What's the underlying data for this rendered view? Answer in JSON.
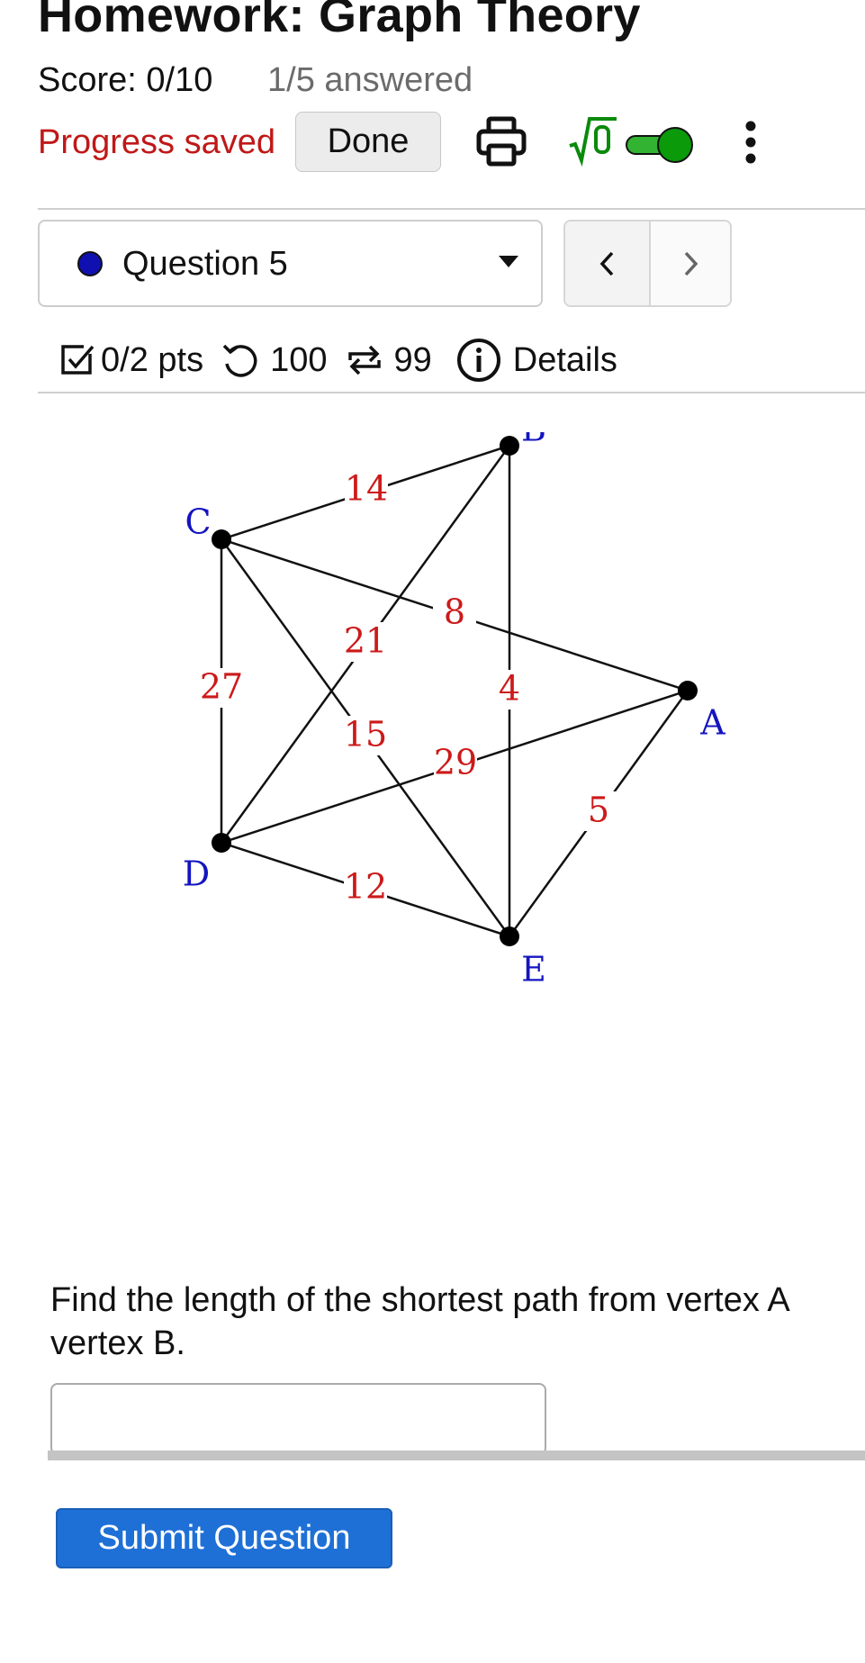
{
  "header": {
    "title": "Homework: Graph Theory",
    "score": "Score: 0/10",
    "answered": "1/5 answered",
    "progress_status": "Progress saved",
    "done_label": "Done",
    "icons": [
      "print-icon",
      "sqrt-math-icon",
      "toggle-switch",
      "more-vert-icon"
    ],
    "toggle_on": true,
    "accent_color": "#009900"
  },
  "question_nav": {
    "selected": "Question 5",
    "dot_color": "#1010b0",
    "prev_icon": "chevron-left-icon",
    "next_icon": "chevron-right-icon"
  },
  "meta": {
    "points": "0/2 pts",
    "attempts": "100",
    "retries": "99",
    "details_label": "Details"
  },
  "graph": {
    "vertices": [
      "A",
      "B",
      "C",
      "D",
      "E"
    ],
    "edges": [
      {
        "from": "B",
        "to": "C",
        "weight": "14"
      },
      {
        "from": "C",
        "to": "A",
        "weight": "8"
      },
      {
        "from": "B",
        "to": "D",
        "weight": "21"
      },
      {
        "from": "C",
        "to": "D",
        "weight": "27"
      },
      {
        "from": "B",
        "to": "E",
        "weight": "4"
      },
      {
        "from": "C",
        "to": "E",
        "weight": "15"
      },
      {
        "from": "A",
        "to": "D",
        "weight": "29"
      },
      {
        "from": "A",
        "to": "E",
        "weight": "5"
      },
      {
        "from": "D",
        "to": "E",
        "weight": "12"
      }
    ],
    "vertex_color": "#1414c0",
    "weight_color": "#cc1a1a"
  },
  "question": {
    "prompt": "Find the length of the shortest path from vertex A vertex B.",
    "answer_value": "",
    "submit_label": "Submit Question",
    "submit_color": "#1f70d6"
  }
}
